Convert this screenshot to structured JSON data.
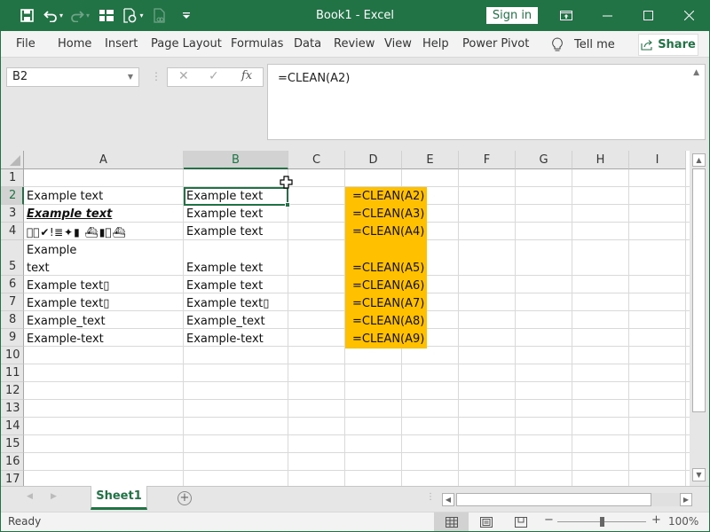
{
  "app": {
    "title": "Book1  -  Excel",
    "sign_in_label": "Sign in"
  },
  "quick_access": [
    {
      "icon": "save-icon"
    },
    {
      "icon": "undo-icon"
    },
    {
      "icon": "redo-icon"
    },
    {
      "icon": "form-icon"
    },
    {
      "icon": "refresh-all-icon"
    },
    {
      "icon": "link-doc-icon"
    },
    {
      "icon": "customize-qat-icon"
    }
  ],
  "ribbon": {
    "tabs": [
      "File",
      "Home",
      "Insert",
      "Page Layout",
      "Formulas",
      "Data",
      "Review",
      "View",
      "Help",
      "Power Pivot"
    ],
    "tell_me": "Tell me",
    "share": "Share"
  },
  "formula_bar": {
    "name_box": "B2",
    "cancel_glyph": "✕",
    "enter_glyph": "✓",
    "fx_label": "fx",
    "formula": "=CLEAN(A2)"
  },
  "sheet": {
    "columns": [
      "A",
      "B",
      "C",
      "D",
      "E",
      "F",
      "G",
      "H",
      "I"
    ],
    "selected_column": "B",
    "rows": [
      "1",
      "2",
      "3",
      "4",
      "5",
      "6",
      "7",
      "8",
      "9",
      "10",
      "11",
      "12",
      "13",
      "14",
      "15",
      "16",
      "17"
    ],
    "selected_row": "2",
    "active_cell": "B2",
    "highlight_color": "#ffc000",
    "cells": {
      "A2": "Example text",
      "A3": "Example text",
      "A4": "🏭⃠✔ǃ≣✦▮  ⛴▮⃠⛴",
      "A5_line1": "Example",
      "A5_line2": "text",
      "A6": "Example text▯",
      "A7": "Example text▯",
      "A8": "Example_text",
      "A9": "Example-text",
      "B2": "Example text",
      "B3": "Example text",
      "B4": "Example text",
      "B5": "Example text",
      "B6": "Example text",
      "B7": "Example text▯",
      "B8": "Example_text",
      "B9": "Example-text",
      "D2": "=CLEAN(A2)",
      "D3": "=CLEAN(A3)",
      "D4": "=CLEAN(A4)",
      "D5": "=CLEAN(A5)",
      "D6": "=CLEAN(A6)",
      "D7": "=CLEAN(A7)",
      "D8": "=CLEAN(A8)",
      "D9": "=CLEAN(A9)"
    }
  },
  "sheet_tabs": {
    "tabs": [
      "Sheet1"
    ],
    "active": "Sheet1",
    "add_label": "+"
  },
  "status_bar": {
    "status": "Ready",
    "zoom_percent": "100%",
    "zoom_level": 100
  },
  "colors": {
    "brand": "#217346",
    "highlight": "#ffc000"
  }
}
